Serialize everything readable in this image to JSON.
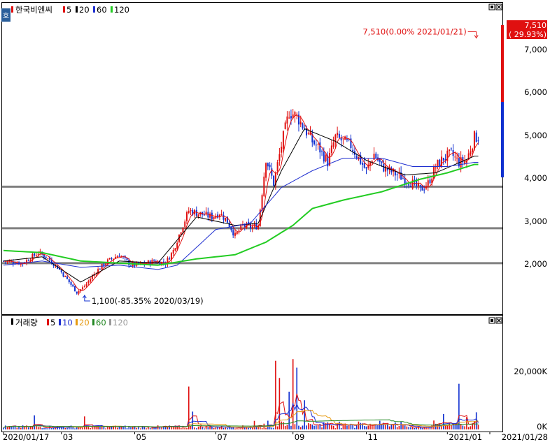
{
  "colors": {
    "up": "#e01010",
    "down": "#1030d0",
    "ma5": "#e01010",
    "ma20": "#000000",
    "ma60": "#1f2fd0",
    "ma120": "#22cc22",
    "vol_ma5": "#e01010",
    "vol_ma10": "#1f2fd0",
    "vol_ma20": "#e69a10",
    "vol_ma60": "#228822",
    "vol_ma120": "#999999",
    "hline": "#808080",
    "frame": "#000000"
  },
  "price_panel": {
    "legend": {
      "name": "한국비엔씨",
      "ma": [
        {
          "label": "5",
          "color_key": "ma5"
        },
        {
          "label": "20",
          "color_key": "ma20"
        },
        {
          "label": "60",
          "color_key": "ma60"
        },
        {
          "label": "120",
          "color_key": "ma120"
        }
      ]
    },
    "corner_glyph": "호",
    "current_annotation": "7,510(0.00% 2021/01/21)",
    "min_annotation": "1,100(-85.35% 2020/03/19)",
    "current_price_badge": "7,510",
    "current_change_badge": "( 29.93%)",
    "y_ticks": [
      "7,000",
      "6,000",
      "5,000",
      "4,000",
      "3,000",
      "2,000"
    ]
  },
  "volume_panel": {
    "legend": {
      "name": "거래량",
      "ma": [
        {
          "label": "5",
          "color_key": "vol_ma5"
        },
        {
          "label": "10",
          "color_key": "vol_ma10"
        },
        {
          "label": "20",
          "color_key": "vol_ma20"
        },
        {
          "label": "60",
          "color_key": "vol_ma60"
        },
        {
          "label": "120",
          "color_key": "vol_ma120"
        }
      ]
    },
    "y_ticks": [
      "20,000K",
      "0K"
    ]
  },
  "x_axis": {
    "labels": [
      "2020/01/17",
      "03",
      "05",
      "07",
      "09",
      "11",
      "2021/01",
      "2021/01/28"
    ]
  },
  "chart_data": {
    "type": "candlestick",
    "price_axis": {
      "min": 850,
      "max": 7900,
      "ticks": [
        2000,
        3000,
        4000,
        5000,
        6000,
        7000
      ]
    },
    "volume_axis": {
      "min": 0,
      "max": 29500,
      "unit": "K",
      "ticks": [
        0,
        20000
      ]
    },
    "x_range": {
      "start": 0,
      "end": 252
    },
    "x_ticks": [
      {
        "label": "2020/01/17",
        "x": 0
      },
      {
        "label": "03",
        "x": 30
      },
      {
        "label": "05",
        "x": 68
      },
      {
        "label": "07",
        "x": 110
      },
      {
        "label": "09",
        "x": 150
      },
      {
        "label": "11",
        "x": 188
      },
      {
        "label": "2021/01",
        "x": 230
      },
      {
        "label": "2021/01/28",
        "x": 252
      }
    ],
    "horizontal_levels": [
      3820,
      2830,
      2000
    ],
    "price_keypoints": [
      [
        0,
        2050
      ],
      [
        10,
        2000
      ],
      [
        18,
        2250
      ],
      [
        22,
        2150
      ],
      [
        28,
        1900
      ],
      [
        34,
        1550
      ],
      [
        38,
        1300
      ],
      [
        42,
        1450
      ],
      [
        48,
        1800
      ],
      [
        54,
        2050
      ],
      [
        60,
        2200
      ],
      [
        66,
        1950
      ],
      [
        72,
        1980
      ],
      [
        78,
        2050
      ],
      [
        84,
        2000
      ],
      [
        88,
        2300
      ],
      [
        92,
        2800
      ],
      [
        96,
        3250
      ],
      [
        100,
        3200
      ],
      [
        104,
        3150
      ],
      [
        108,
        3100
      ],
      [
        112,
        3200
      ],
      [
        116,
        3000
      ],
      [
        120,
        2650
      ],
      [
        124,
        2900
      ],
      [
        128,
        2850
      ],
      [
        132,
        2900
      ],
      [
        136,
        4500
      ],
      [
        140,
        3900
      ],
      [
        144,
        4800
      ],
      [
        148,
        5600
      ],
      [
        152,
        5500
      ],
      [
        156,
        5200
      ],
      [
        160,
        4900
      ],
      [
        164,
        4700
      ],
      [
        168,
        4400
      ],
      [
        172,
        5000
      ],
      [
        176,
        4900
      ],
      [
        180,
        4800
      ],
      [
        184,
        4500
      ],
      [
        188,
        4200
      ],
      [
        192,
        4600
      ],
      [
        196,
        4300
      ],
      [
        200,
        4200
      ],
      [
        204,
        4100
      ],
      [
        208,
        4000
      ],
      [
        212,
        3900
      ],
      [
        216,
        3750
      ],
      [
        220,
        3900
      ],
      [
        224,
        4300
      ],
      [
        228,
        4500
      ],
      [
        232,
        4600
      ],
      [
        236,
        4400
      ],
      [
        240,
        4450
      ],
      [
        244,
        5000
      ]
    ],
    "ma_keypoints": {
      "ma20": [
        [
          0,
          2050
        ],
        [
          20,
          2150
        ],
        [
          40,
          1550
        ],
        [
          60,
          2050
        ],
        [
          80,
          2000
        ],
        [
          100,
          3100
        ],
        [
          120,
          2900
        ],
        [
          132,
          2950
        ],
        [
          144,
          4200
        ],
        [
          156,
          5200
        ],
        [
          172,
          4900
        ],
        [
          188,
          4450
        ],
        [
          208,
          4100
        ],
        [
          224,
          4150
        ],
        [
          244,
          4550
        ]
      ],
      "ma60": [
        [
          0,
          1950
        ],
        [
          20,
          2050
        ],
        [
          40,
          1900
        ],
        [
          60,
          1950
        ],
        [
          80,
          1850
        ],
        [
          90,
          1950
        ],
        [
          110,
          2800
        ],
        [
          128,
          2950
        ],
        [
          144,
          3800
        ],
        [
          160,
          4200
        ],
        [
          176,
          4500
        ],
        [
          196,
          4500
        ],
        [
          212,
          4300
        ],
        [
          230,
          4300
        ],
        [
          244,
          4400
        ]
      ],
      "ma120": [
        [
          0,
          2300
        ],
        [
          20,
          2250
        ],
        [
          40,
          2050
        ],
        [
          60,
          2000
        ],
        [
          80,
          1950
        ],
        [
          100,
          2100
        ],
        [
          120,
          2200
        ],
        [
          136,
          2500
        ],
        [
          150,
          2900
        ],
        [
          160,
          3300
        ],
        [
          176,
          3500
        ],
        [
          196,
          3700
        ],
        [
          216,
          4000
        ],
        [
          230,
          4150
        ],
        [
          244,
          4350
        ]
      ]
    },
    "volume_spikes": [
      {
        "x": 16,
        "value": 4100
      },
      {
        "x": 42,
        "value": 3800
      },
      {
        "x": 96,
        "value": 12500
      },
      {
        "x": 98,
        "value": 5200
      },
      {
        "x": 130,
        "value": 2500
      },
      {
        "x": 141,
        "value": 20000
      },
      {
        "x": 143,
        "value": 15000
      },
      {
        "x": 148,
        "value": 11000
      },
      {
        "x": 150,
        "value": 20500
      },
      {
        "x": 152,
        "value": 18000
      },
      {
        "x": 156,
        "value": 8500
      },
      {
        "x": 184,
        "value": 2300
      },
      {
        "x": 228,
        "value": 4500
      },
      {
        "x": 236,
        "value": 13300
      },
      {
        "x": 240,
        "value": 3600
      },
      {
        "x": 245,
        "value": 5000
      },
      {
        "x": 247,
        "value": 4000
      }
    ],
    "annotations": [
      {
        "text": "7,510(0.00% 2021/01/21)",
        "x": 245,
        "price": 7510
      },
      {
        "text": "1,100(-85.35% 2020/03/19)",
        "x": 42,
        "price": 1100
      }
    ]
  }
}
